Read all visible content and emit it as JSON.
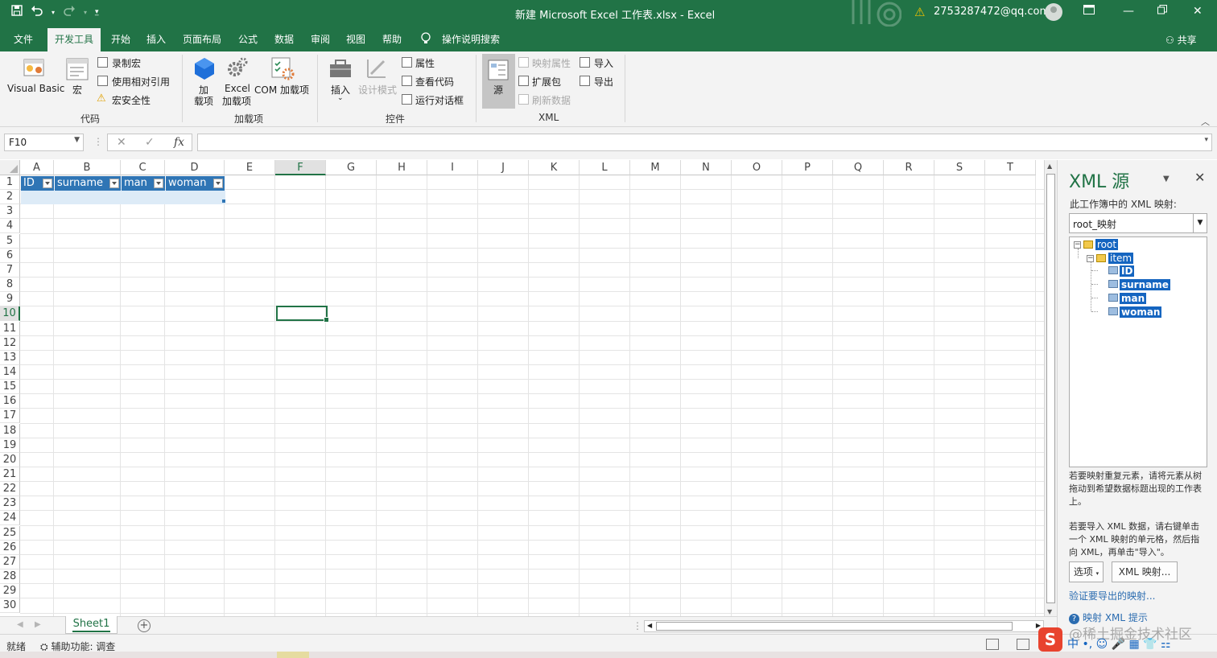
{
  "window": {
    "title": "新建 Microsoft Excel 工作表.xlsx  -  Excel",
    "user": "2753287472@qq.com",
    "share": "共享",
    "colors": {
      "brand": "#217346",
      "table_header": "#2f75b5",
      "tree_selection": "#1565c0"
    }
  },
  "quick_access": {
    "save": "save-icon",
    "undo": "undo-icon",
    "redo": "redo-icon",
    "customize": "customize-icon"
  },
  "menu": {
    "tabs": [
      "文件",
      "开发工具",
      "开始",
      "插入",
      "页面布局",
      "公式",
      "数据",
      "审阅",
      "视图",
      "帮助"
    ],
    "active": "开发工具",
    "search": "操作说明搜索"
  },
  "ribbon": {
    "code": {
      "label": "代码",
      "visual_basic": "Visual Basic",
      "macros": "宏",
      "record_macro": "录制宏",
      "relative_ref": "使用相对引用",
      "macro_security": "宏安全性"
    },
    "addins": {
      "label": "加载项",
      "addins_line1": "加",
      "addins_line2": "载项",
      "excel_addins_line1": "Excel",
      "excel_addins_line2": "加载项",
      "com_addins": "COM 加载项"
    },
    "controls": {
      "label": "控件",
      "insert": "插入",
      "design_mode": "设计模式",
      "properties": "属性",
      "view_code": "查看代码",
      "run_dialog": "运行对话框"
    },
    "xml": {
      "label": "XML",
      "source": "源",
      "map_properties": "映射属性",
      "expansion_packs": "扩展包",
      "refresh_data": "刷新数据",
      "import": "导入",
      "export": "导出"
    }
  },
  "formula_bar": {
    "name_box": "F10",
    "cancel": "✕",
    "enter": "✓",
    "fx": "fx",
    "value": ""
  },
  "sheet": {
    "columns": [
      "A",
      "B",
      "C",
      "D",
      "E",
      "F",
      "G",
      "H",
      "I",
      "J",
      "K",
      "L",
      "M",
      "N",
      "O",
      "P",
      "Q",
      "R",
      "S",
      "T"
    ],
    "rows": [
      "1",
      "2",
      "3",
      "4",
      "5",
      "6",
      "7",
      "8",
      "9",
      "10",
      "11",
      "12",
      "13",
      "14",
      "15",
      "16",
      "17",
      "18",
      "19",
      "20",
      "21",
      "22",
      "23",
      "24",
      "25",
      "26",
      "27",
      "28",
      "29",
      "30"
    ],
    "selected_column": "F",
    "selected_row": "10",
    "table_headers": [
      "ID",
      "surname",
      "man",
      "woman"
    ],
    "tab": "Sheet1"
  },
  "status": {
    "ready": "就绪",
    "accessibility": "辅助功能: 调查"
  },
  "xml_pane": {
    "title": "XML 源",
    "maps_label": "此工作簿中的 XML 映射:",
    "selected_map": "root_映射",
    "tree": {
      "root": "root",
      "item": "item",
      "fields": [
        "ID",
        "surname",
        "man",
        "woman"
      ]
    },
    "help1": "若要映射重复元素，请将元素从树拖动到希望数据标题出现的工作表上。",
    "help2": "若要导入 XML 数据，请右键单击一个 XML 映射的单元格，然后指向 XML，再单击\"导入\"。",
    "options_button": "选项",
    "xml_maps_button": "XML 映射...",
    "verify_link": "验证要导出的映射...",
    "tips_link": "映射 XML 提示"
  },
  "overlay": {
    "watermark": "@稀土掘金技术社区",
    "ime_logo": "S",
    "ime_toolbar": "中 •, ☺ 🎤 ▦ 👕 ⚏"
  }
}
